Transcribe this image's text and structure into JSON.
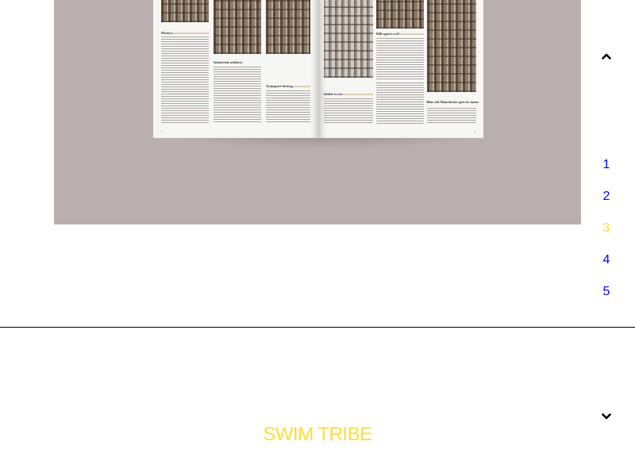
{
  "hero": {
    "left_page_headings": [
      "History",
      "Industrial artifacts",
      "Transport heritage"
    ],
    "right_page_headings": [
      "Mill spaces with",
      "Subtle to see",
      "Blue old Manchester gets its name"
    ]
  },
  "pagination": {
    "up_icon": "chevron-up-icon",
    "down_icon": "chevron-down-icon",
    "pages": [
      "1",
      "2",
      "3",
      "4",
      "5"
    ],
    "active_page": "3",
    "link_color": "#0000ee",
    "active_color": "#ffdd33"
  },
  "brand": {
    "name": "SWIM TRIBE",
    "color": "#ffdd33"
  }
}
